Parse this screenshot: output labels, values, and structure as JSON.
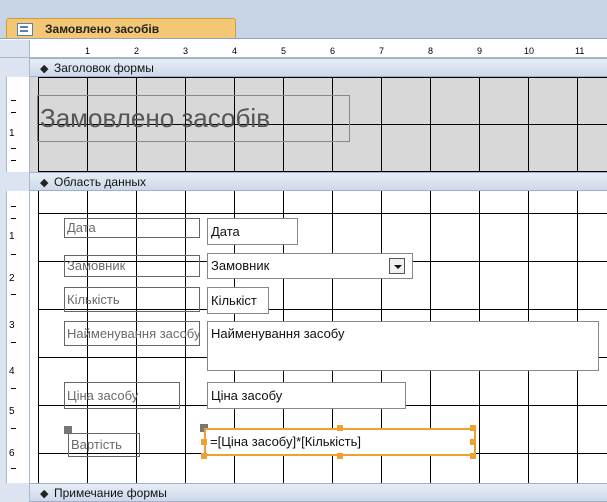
{
  "tab": {
    "title": "Замовлено засобів",
    "icon": "form-icon"
  },
  "ruler": {
    "ticks": [
      "1",
      "2",
      "3",
      "4",
      "5",
      "6",
      "7",
      "8",
      "9",
      "10",
      "11"
    ]
  },
  "vruler": {
    "header_numbers": [
      "1"
    ],
    "detail_numbers": [
      "1",
      "2",
      "3",
      "4",
      "5",
      "6"
    ]
  },
  "sections": {
    "header_title": "Заголовок формы",
    "detail_title": "Область данных",
    "footer_title": "Примечание формы"
  },
  "form_header": {
    "title": "Замовлено засобів"
  },
  "detail": {
    "date_label": "Дата",
    "date_value": "Дата",
    "customer_label": "Замовник",
    "customer_value": "Замовник",
    "qty_label": "Кількість",
    "qty_value": "Кількіст",
    "name_label": "Найменування засобу",
    "name_value": "Найменування засобу",
    "price_label": "Ціна засобу",
    "price_value": "Ціна засобу",
    "cost_label": "Вартість",
    "cost_value": "=[Ціна засобу]*[Кількість]"
  },
  "colors": {
    "tab": "#f4c774",
    "selection": "#f0a030",
    "section_bar": "#cdd9e9"
  }
}
